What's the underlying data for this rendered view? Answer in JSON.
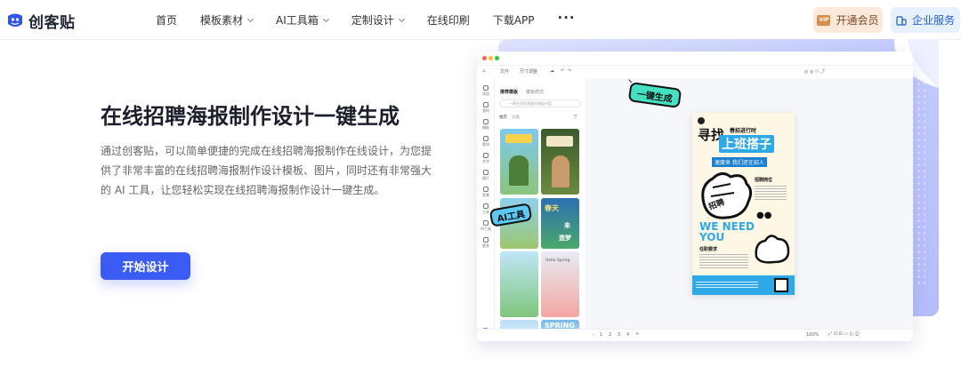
{
  "brand": {
    "name": "创客贴",
    "primary_color": "#3a5cf5"
  },
  "nav": {
    "links": [
      {
        "label": "首页",
        "dropdown": false
      },
      {
        "label": "模板素材",
        "dropdown": true
      },
      {
        "label": "AI工具箱",
        "dropdown": true
      },
      {
        "label": "定制设计",
        "dropdown": true
      },
      {
        "label": "在线印刷",
        "dropdown": false
      },
      {
        "label": "下载APP",
        "dropdown": false
      }
    ],
    "more": "···",
    "vip": {
      "label": "开通会员",
      "badge": "VIP"
    },
    "business": {
      "label": "企业服务"
    }
  },
  "hero": {
    "title": "在线招聘海报制作设计一键生成",
    "description": "通过创客贴，可以简单便捷的完成在线招聘海报制作在线设计，为您提供了非常丰富的在线招聘海报制作设计模板、图片，同时还有非常强大的 AI 工具，让您轻松实现在线招聘海报制作设计一键生成。",
    "cta": "开始设计"
  },
  "mockup": {
    "stickers": {
      "one_click": "一键生成",
      "ai_tool": "AI工具"
    },
    "toolbar": {
      "file": "文件",
      "size": "尺寸调整"
    },
    "panel": {
      "tab_active": "推荐模板",
      "tab_other": "模板样式",
      "search_placeholder": "一键生成您想要的模板内容",
      "filter_a": "推荐",
      "filter_b": "分类"
    },
    "rail_items": [
      "添加",
      "我的",
      "模板",
      "素材",
      "文字",
      "图片",
      "背景",
      "工具",
      "AI工具",
      "更多"
    ],
    "poster": {
      "line1": "寻找",
      "tag": "春招进行时",
      "line2": "上班搭子",
      "sub": "速度来 我们还在招人",
      "stamp": "招聘",
      "we_need": "WE NEED",
      "you": "YOU",
      "section1": "招聘岗位",
      "section2": "任职要求"
    },
    "thumb_texts": [
      "春天",
      "来",
      "造梦",
      "SPRING",
      "Hello Spring"
    ],
    "zoom": "100%",
    "pages": [
      "1",
      "2",
      "3",
      "4"
    ]
  }
}
